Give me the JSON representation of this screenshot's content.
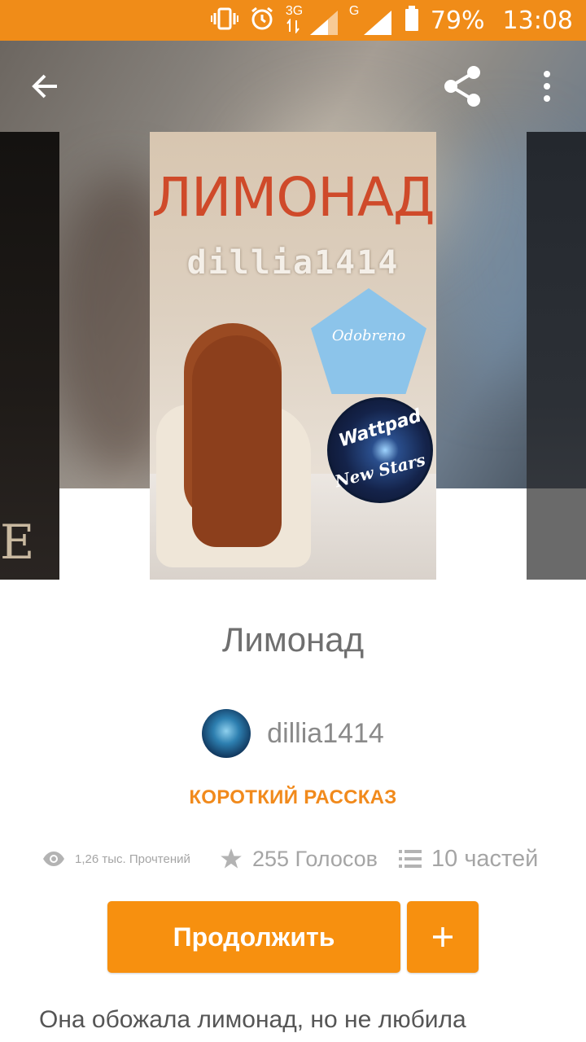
{
  "status_bar": {
    "network_3g": "3G",
    "network_g": "G",
    "battery_percent": "79%",
    "time": "13:08",
    "icons": [
      "vibrate-icon",
      "alarm-icon",
      "signal-3g-icon",
      "signal-g-icon",
      "battery-icon"
    ],
    "bg_color": "#f08c18"
  },
  "toolbar": {
    "icons": [
      "back-arrow-icon",
      "share-icon",
      "more-vert-icon"
    ]
  },
  "cover": {
    "title_text": "ЛИМОНАД",
    "author_text": "dillia1414",
    "badge_text": "Odobreno",
    "badge2_top": "Wattpad",
    "badge2_bottom": "New Stars",
    "side_left_letter": "E"
  },
  "story": {
    "title": "Лимонад",
    "author": "dillia1414",
    "type": "КОРОТКИЙ РАССКАЗ",
    "reads": "1,26 тыс. Прочтений",
    "votes": "255 Голосов",
    "parts": "10 частей",
    "description": "Она обожала лимонад, но не любила"
  },
  "actions": {
    "continue_label": "Продолжить",
    "add_label": "+",
    "accent_color": "#f7900f"
  }
}
